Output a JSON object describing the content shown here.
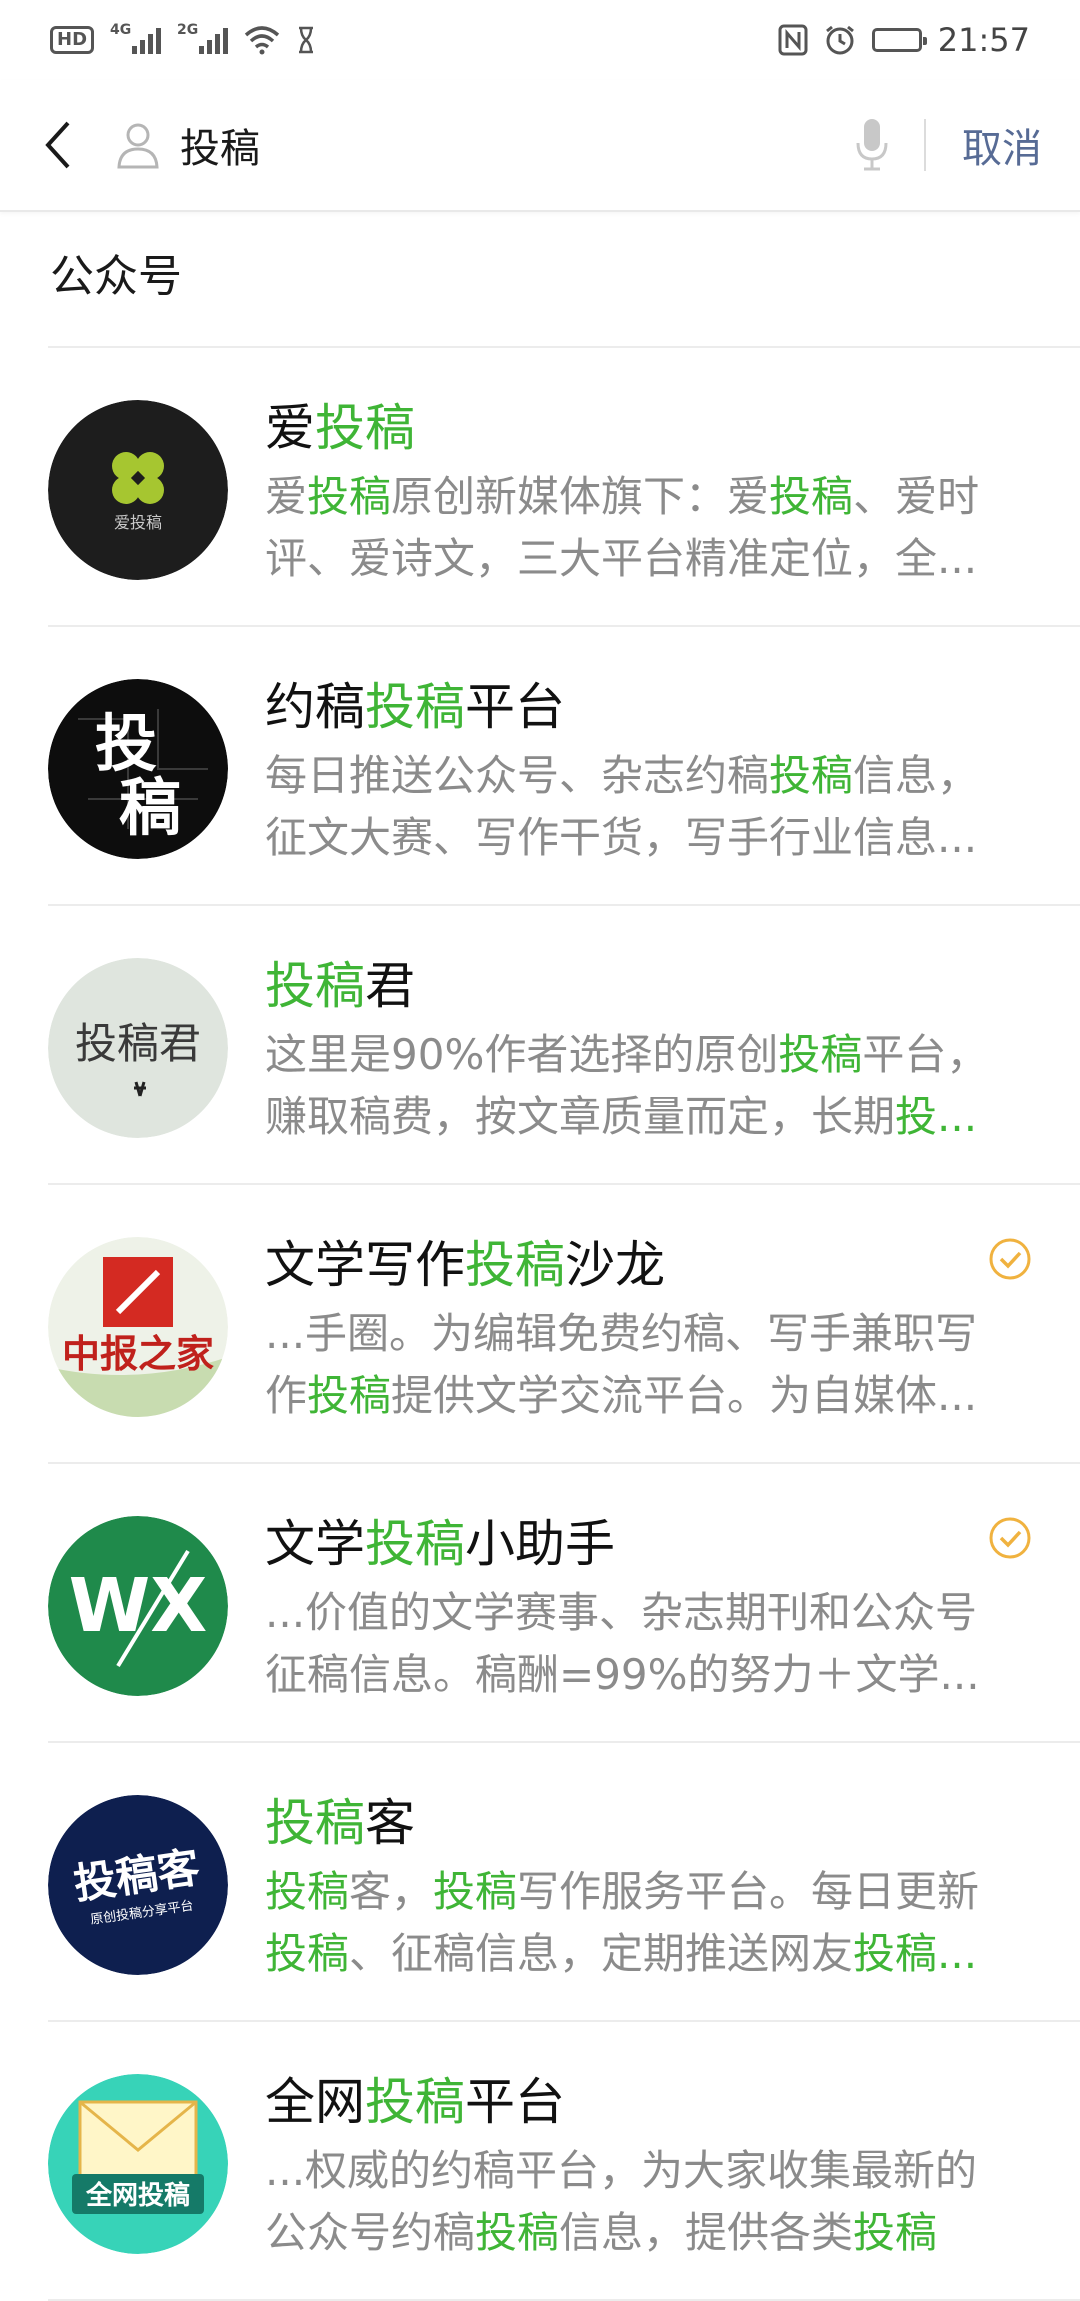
{
  "status_bar": {
    "hd": "HD",
    "sig1_gen": "4G",
    "sig2_gen": "2G",
    "time": "21:57"
  },
  "search": {
    "query": "投稿",
    "cancel_label": "取消"
  },
  "section": {
    "title": "公众号"
  },
  "accent": "#3fb536",
  "results": [
    {
      "name": [
        {
          "t": "爱"
        },
        {
          "t": "投稿",
          "h": true
        }
      ],
      "desc": [
        [
          {
            "t": "爱"
          },
          {
            "t": "投稿",
            "h": true
          },
          {
            "t": "原创新媒体旗下：爱"
          },
          {
            "t": "投稿",
            "h": true
          },
          {
            "t": "、爱时"
          }
        ],
        [
          {
            "t": "评、爱诗文，三大平台精准定位，全..."
          }
        ]
      ],
      "verified": false
    },
    {
      "name": [
        {
          "t": "约稿"
        },
        {
          "t": "投稿",
          "h": true
        },
        {
          "t": "平台"
        }
      ],
      "desc": [
        [
          {
            "t": "每日推送公众号、杂志约稿"
          },
          {
            "t": "投稿",
            "h": true
          },
          {
            "t": "信息，"
          }
        ],
        [
          {
            "t": "征文大赛、写作干货，写手行业信息..."
          }
        ]
      ],
      "verified": false
    },
    {
      "name": [
        {
          "t": "投稿",
          "h": true
        },
        {
          "t": "君"
        }
      ],
      "desc": [
        [
          {
            "t": "这里是90%作者选择的原创"
          },
          {
            "t": "投稿",
            "h": true
          },
          {
            "t": "平台，"
          }
        ],
        [
          {
            "t": "赚取稿费，按文章质量而定，长期"
          },
          {
            "t": "投...",
            "h": true
          }
        ]
      ],
      "verified": false
    },
    {
      "name": [
        {
          "t": "文学写作"
        },
        {
          "t": "投稿",
          "h": true
        },
        {
          "t": "沙龙"
        }
      ],
      "desc": [
        [
          {
            "t": "...手圈。为编辑免费约稿、写手兼职写"
          }
        ],
        [
          {
            "t": "作"
          },
          {
            "t": "投稿",
            "h": true
          },
          {
            "t": "提供文学交流平台。为自媒体..."
          }
        ]
      ],
      "verified": true
    },
    {
      "name": [
        {
          "t": "文学"
        },
        {
          "t": "投稿",
          "h": true
        },
        {
          "t": "小助手"
        }
      ],
      "desc": [
        [
          {
            "t": "...价值的文学赛事、杂志期刊和公众号"
          }
        ],
        [
          {
            "t": "征稿信息。稿酬=99%的努力＋文学..."
          }
        ]
      ],
      "verified": true
    },
    {
      "name": [
        {
          "t": "投稿",
          "h": true
        },
        {
          "t": "客"
        }
      ],
      "desc": [
        [
          {
            "t": "投稿",
            "h": true
          },
          {
            "t": "客，"
          },
          {
            "t": "投稿",
            "h": true
          },
          {
            "t": "写作服务平台。每日更新"
          }
        ],
        [
          {
            "t": "投稿",
            "h": true
          },
          {
            "t": "、征稿信息，定期推送网友"
          },
          {
            "t": "投稿...",
            "h": true
          }
        ]
      ],
      "verified": false
    },
    {
      "name": [
        {
          "t": "全网"
        },
        {
          "t": "投稿",
          "h": true
        },
        {
          "t": "平台"
        }
      ],
      "desc": [
        [
          {
            "t": "...权威的约稿平台，为大家收集最新的"
          }
        ],
        [
          {
            "t": "公众号约稿"
          },
          {
            "t": "投稿",
            "h": true
          },
          {
            "t": "信息，提供各类"
          },
          {
            "t": "投稿",
            "h": true
          }
        ]
      ],
      "verified": false
    }
  ],
  "avatars": {
    "a1_logo_text": "爱投稿",
    "a2_text": [
      "投",
      "稿"
    ],
    "a3_text": "投稿君",
    "a4_text": "中报之家",
    "a5_text": "WX",
    "a6_text": "投稿客",
    "a6_sub": "原创投稿分享平台",
    "a7_text": "全网投稿"
  }
}
